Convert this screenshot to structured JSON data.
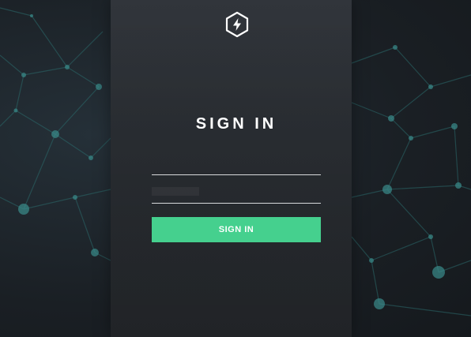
{
  "login": {
    "title": "SIGN IN",
    "username_value": "",
    "password_value": "",
    "submit_label": "SIGN IN",
    "logo_icon": "lightning-hexagon-icon"
  },
  "colors": {
    "accent": "#45d08e",
    "panel": "#2e3237",
    "background": "#1b2025",
    "network_lines": "#2f6e6e"
  }
}
